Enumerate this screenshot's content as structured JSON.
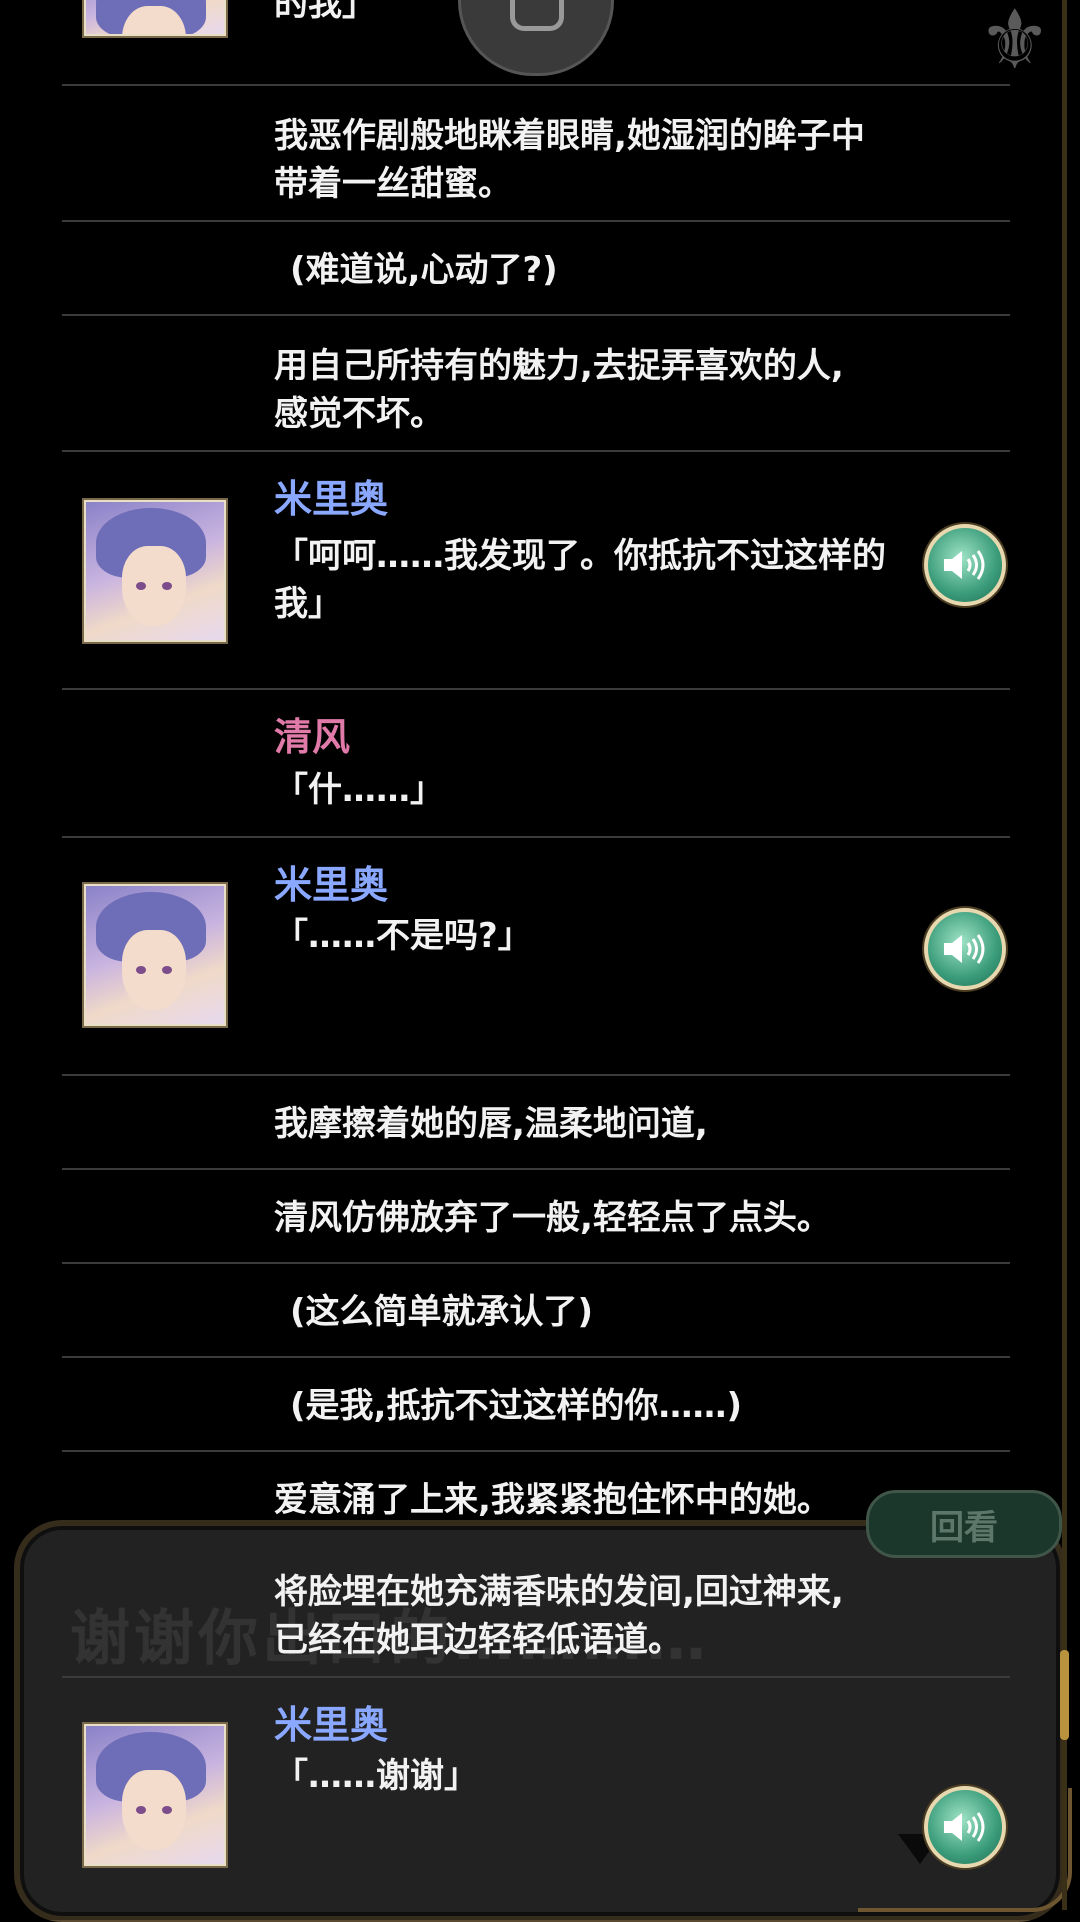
{
  "background": {
    "textbox_text": "谢谢你出口的…………",
    "review_tab_label": "回看"
  },
  "backlog": {
    "entries": [
      {
        "type": "voice",
        "speaker": "",
        "text": "的我」",
        "partial": true
      },
      {
        "type": "narration",
        "text": "我恶作剧般地眯着眼睛,她湿润的眸子中带着一丝甜蜜。"
      },
      {
        "type": "thought",
        "text": "(难道说,心动了?)"
      },
      {
        "type": "narration",
        "text": "用自己所持有的魅力,去捉弄喜欢的人,感觉不坏。"
      },
      {
        "type": "voice",
        "speaker": "米里奥",
        "speaker_color": "#8aa8ff",
        "text": "「呵呵……我发现了。你抵抗不过这样的我」"
      },
      {
        "type": "dialogue",
        "speaker": "清风",
        "speaker_color": "#e07aa8",
        "text": "「什……」"
      },
      {
        "type": "voice",
        "speaker": "米里奥",
        "speaker_color": "#8aa8ff",
        "text": "「……不是吗?」"
      },
      {
        "type": "narration",
        "text": "我摩擦着她的唇,温柔地问道,"
      },
      {
        "type": "narration",
        "text": "清风仿佛放弃了一般,轻轻点了点头。"
      },
      {
        "type": "thought",
        "text": "(这么简单就承认了)"
      },
      {
        "type": "thought",
        "text": "(是我,抵抗不过这样的你……)"
      },
      {
        "type": "narration",
        "text": "爱意涌了上来,我紧紧抱住怀中的她。"
      },
      {
        "type": "narration",
        "text": "将脸埋在她充满香味的发间,回过神来,已经在她耳边轻轻低语道。"
      },
      {
        "type": "voice",
        "speaker": "米里奥",
        "speaker_color": "#8aa8ff",
        "text": "「……谢谢」"
      }
    ]
  },
  "icons": {
    "voice": "speaker-volume-icon",
    "avatar": "character-portrait-milio",
    "fleur": "fleur-de-lis-icon",
    "advance": "down-arrow-icon"
  }
}
